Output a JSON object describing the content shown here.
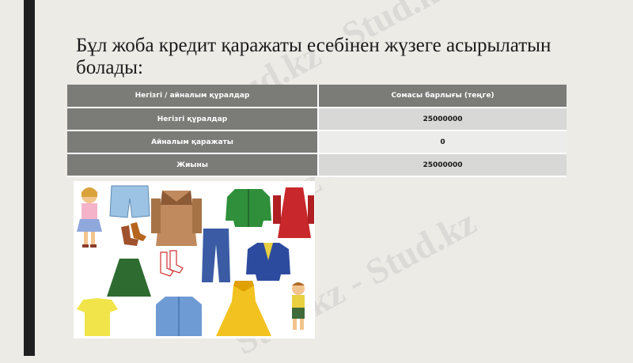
{
  "slide": {
    "title": "Бұл жоба кредит қаражаты есебінен жүзеге асырылатын болады:",
    "watermark": "Stud.kz - Stud.kz"
  },
  "table": {
    "headers": [
      "Негізгі / айналым құралдар",
      "Сомасы барлығы (теңге)"
    ],
    "rows": [
      {
        "label": "Негізгі құралдар",
        "value": "25000000"
      },
      {
        "label": "Айналым қаражаты",
        "value": "0"
      },
      {
        "label": "Жиыны",
        "value": "25000000"
      }
    ]
  },
  "image": {
    "subject": "clothing illustration"
  }
}
